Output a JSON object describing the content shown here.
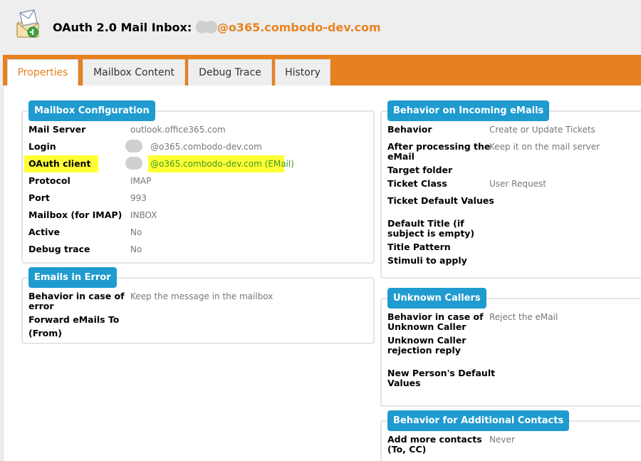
{
  "header": {
    "title_prefix": "OAuth 2.0 Mail Inbox:",
    "title_email": "@o365.combodo-dev.com",
    "icon": "mailbox-icon"
  },
  "tabs": [
    {
      "label": "Properties",
      "active": true
    },
    {
      "label": "Mailbox Content",
      "active": false
    },
    {
      "label": "Debug Trace",
      "active": false
    },
    {
      "label": "History",
      "active": false
    }
  ],
  "mailbox_config": {
    "legend": "Mailbox Configuration",
    "rows": [
      {
        "label": "Mail Server",
        "value": "outlook.office365.com"
      },
      {
        "label": "Login",
        "value": "@o365.combodo-dev.com"
      },
      {
        "label": "OAuth client",
        "value": "@o365.combodo-dev.com (EMail)"
      },
      {
        "label": "Protocol",
        "value": "IMAP"
      },
      {
        "label": "Port",
        "value": "993"
      },
      {
        "label": "Mailbox (for IMAP)",
        "value": "INBOX"
      },
      {
        "label": "Active",
        "value": "No"
      },
      {
        "label": "Debug trace",
        "value": "No"
      }
    ]
  },
  "emails_in_error": {
    "legend": "Emails in Error",
    "behavior_label_1": "Behavior in case of",
    "behavior_label_2": "error",
    "behavior_value": "Keep the message in the mailbox",
    "forward_label": "Forward eMails To",
    "forward_label_2": "(From)"
  },
  "incoming": {
    "legend": "Behavior on Incoming eMails",
    "behavior_label": "Behavior",
    "behavior_value": "Create or Update Tickets",
    "after_label_1": "After processing the",
    "after_label_2": "eMail",
    "after_value": "Keep it on the mail server",
    "target_folder_label": "Target folder",
    "ticket_class_label": "Ticket Class",
    "ticket_class_value": "User Request",
    "ticket_default_label": "Ticket Default Values",
    "default_title_label_1": "Default Title (if",
    "default_title_label_2": "subject is empty)",
    "title_pattern_label": "Title Pattern",
    "stimuli_label": "Stimuli to apply"
  },
  "unknown_callers": {
    "legend": "Unknown Callers",
    "behavior_label_1": "Behavior in case of",
    "behavior_label_2": "Unknown Caller",
    "behavior_value": "Reject the eMail",
    "rejection_label_1": "Unknown Caller",
    "rejection_label_2": "rejection reply",
    "new_person_label_1": "New Person's Default",
    "new_person_label_2": "Values"
  },
  "additional_contacts": {
    "legend": "Behavior for Additional Contacts",
    "add_label_1": "Add more contacts",
    "add_label_2": "(To, CC)",
    "add_value": "Never"
  },
  "colors": {
    "accent": "#e7801f",
    "legend_blue": "#1f9bd0",
    "highlight": "#ffff33",
    "link_green": "#3f9b2a"
  }
}
